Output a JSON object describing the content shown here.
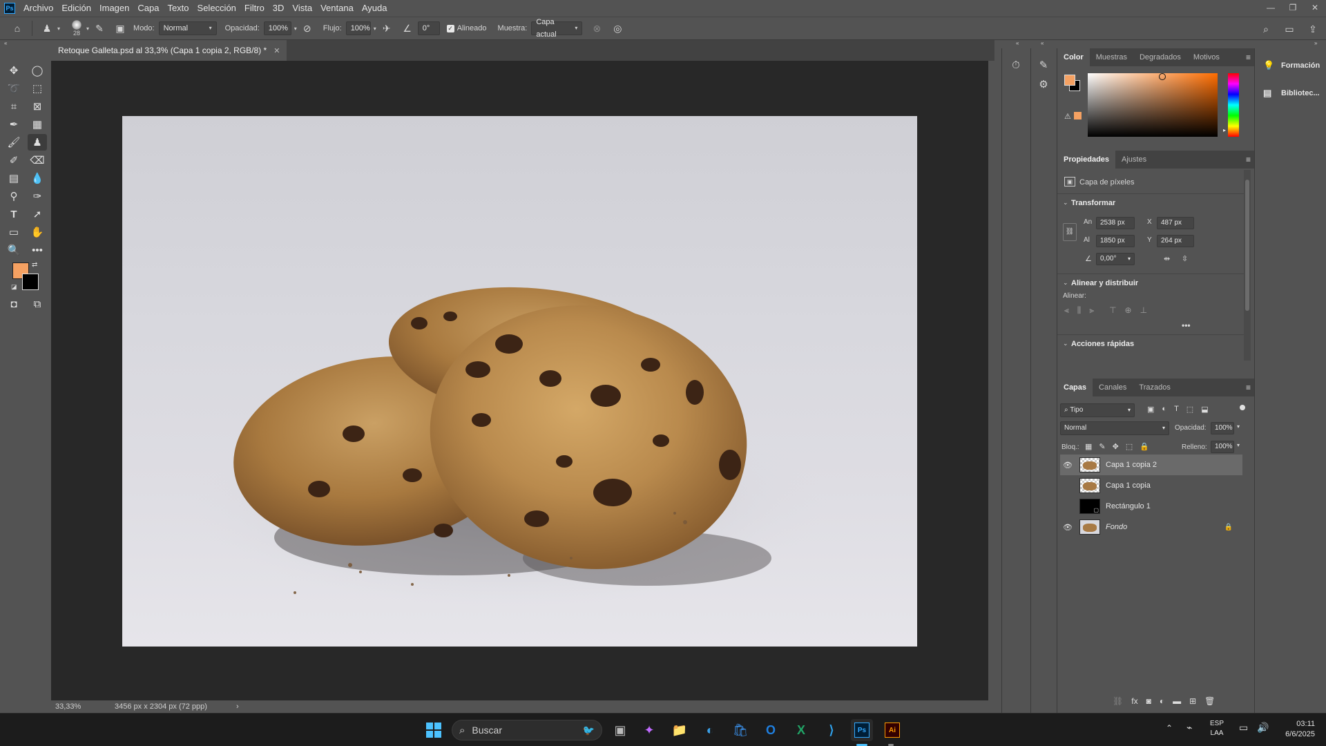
{
  "app": {
    "logo": "Ps"
  },
  "menu": [
    "Archivo",
    "Edición",
    "Imagen",
    "Capa",
    "Texto",
    "Selección",
    "Filtro",
    "3D",
    "Vista",
    "Ventana",
    "Ayuda"
  ],
  "window_controls": {
    "minimize": "—",
    "restore": "❐",
    "close": "✕"
  },
  "options": {
    "brush_size": "28",
    "mode_label": "Modo:",
    "mode_value": "Normal",
    "opacity_label": "Opacidad:",
    "opacity_value": "100%",
    "flow_label": "Flujo:",
    "flow_value": "100%",
    "angle_value": "0°",
    "aligned_label": "Alineado",
    "sample_label": "Muestra:",
    "sample_value": "Capa actual"
  },
  "document": {
    "tab_title": "Retoque Galleta.psd al 33,3% (Capa 1 copia 2, RGB/8) *",
    "zoom": "33,33%",
    "doc_info": "3456 px x 2304 px (72 ppp)"
  },
  "color_panel": {
    "tabs": [
      "Color",
      "Muestras",
      "Degradados",
      "Motivos"
    ],
    "foreground": "#f5a162",
    "background": "#000000"
  },
  "properties_panel": {
    "tabs": [
      "Propiedades",
      "Ajustes"
    ],
    "layer_type": "Capa de píxeles",
    "transform_title": "Transformar",
    "w_label": "An",
    "w_value": "2538 px",
    "h_label": "Al",
    "h_value": "1850 px",
    "x_label": "X",
    "x_value": "487 px",
    "y_label": "Y",
    "y_value": "264 px",
    "angle_value": "0,00°",
    "align_title": "Alinear y distribuir",
    "align_label": "Alinear:",
    "quick_actions_title": "Acciones rápidas"
  },
  "layers_panel": {
    "tabs": [
      "Capas",
      "Canales",
      "Trazados"
    ],
    "filter_value": "Tipo",
    "blend_mode": "Normal",
    "opacity_label": "Opacidad:",
    "opacity_value": "100%",
    "lock_label": "Bloq.:",
    "fill_label": "Relleno:",
    "fill_value": "100%",
    "layers": [
      {
        "name": "Capa 1 copia 2",
        "visible": true,
        "selected": true
      },
      {
        "name": "Capa 1 copia",
        "visible": false,
        "selected": false
      },
      {
        "name": "Rectángulo 1",
        "visible": false,
        "selected": false
      },
      {
        "name": "Fondo",
        "visible": true,
        "selected": false
      }
    ]
  },
  "right_panel": {
    "items": [
      "Formación",
      "Bibliotec..."
    ]
  },
  "taskbar": {
    "search_placeholder": "Buscar",
    "lang_top": "ESP",
    "lang_bottom": "LAA",
    "time": "03:11",
    "date": "6/6/2025"
  }
}
